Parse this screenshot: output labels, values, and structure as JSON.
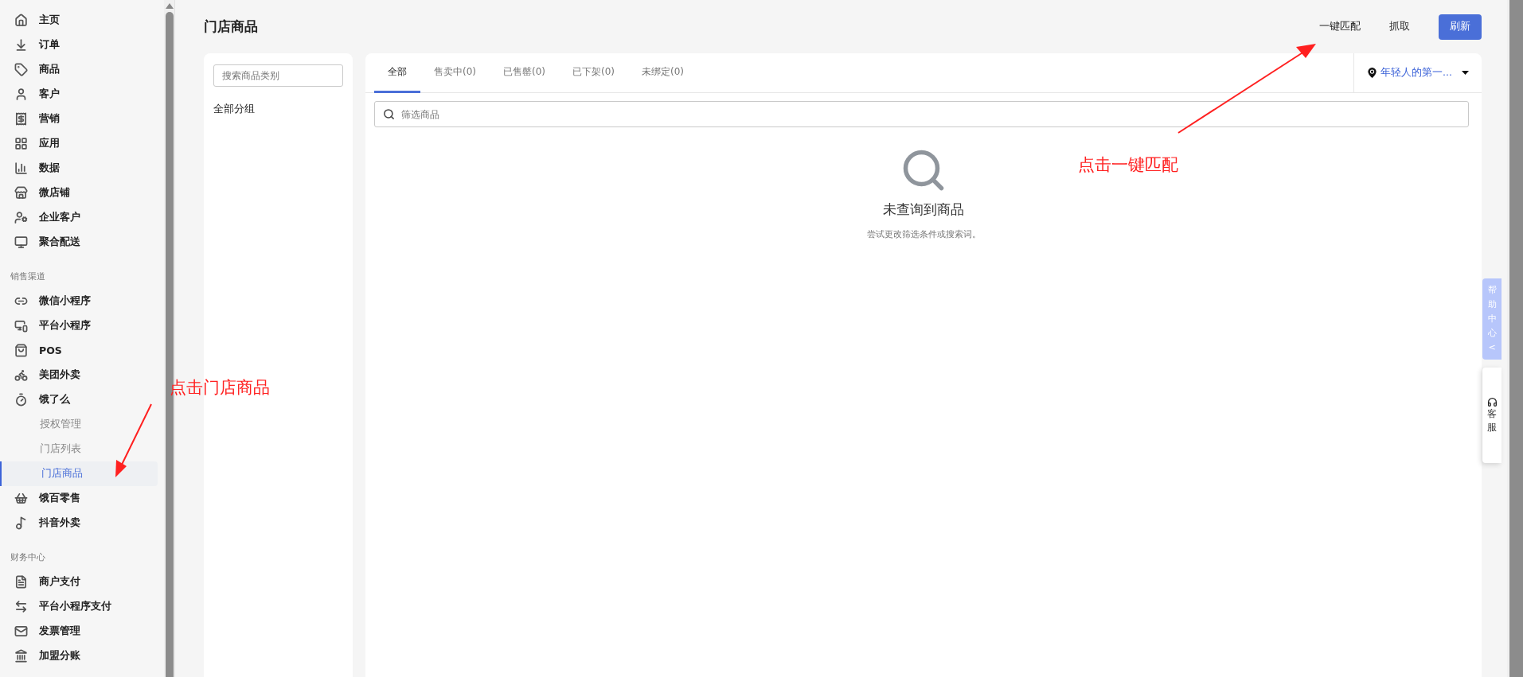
{
  "sidebar": {
    "groups": [
      {
        "items": [
          {
            "label": "主页",
            "selected": false
          },
          {
            "label": "订单",
            "selected": false
          },
          {
            "label": "商品",
            "selected": false
          },
          {
            "label": "客户",
            "selected": false
          },
          {
            "label": "营销",
            "selected": false
          },
          {
            "label": "应用",
            "selected": false
          },
          {
            "label": "数据",
            "selected": false
          },
          {
            "label": "微店铺",
            "selected": false
          },
          {
            "label": "企业客户",
            "selected": false
          },
          {
            "label": "聚合配送",
            "selected": false
          }
        ]
      },
      {
        "label": "销售渠道",
        "items": [
          {
            "label": "微信小程序",
            "selected": false
          },
          {
            "label": "平台小程序",
            "selected": false
          },
          {
            "label": "POS",
            "selected": false
          },
          {
            "label": "美团外卖",
            "selected": false
          },
          {
            "label": "饿了么",
            "selected": false,
            "children": [
              {
                "label": "授权管理",
                "selected": false
              },
              {
                "label": "门店列表",
                "selected": false
              },
              {
                "label": "门店商品",
                "selected": true
              }
            ]
          },
          {
            "label": "饿百零售",
            "selected": false
          },
          {
            "label": "抖音外卖",
            "selected": false
          }
        ]
      },
      {
        "label": "财务中心",
        "items": [
          {
            "label": "商户支付",
            "selected": false
          },
          {
            "label": "平台小程序支付",
            "selected": false
          },
          {
            "label": "发票管理",
            "selected": false
          },
          {
            "label": "加盟分账",
            "selected": false
          }
        ]
      }
    ]
  },
  "page": {
    "title": "门店商品",
    "actions": [
      "一键匹配",
      "抓取"
    ],
    "primary_action": "刷新"
  },
  "category_panel": {
    "search": {
      "placeholder": "搜索商品类别"
    },
    "items": [
      "全部分组"
    ]
  },
  "tabs": [
    {
      "label": "全部",
      "selected": true
    },
    {
      "label": "售卖中(0)",
      "selected": false
    },
    {
      "label": "已售罄(0)",
      "selected": false
    },
    {
      "label": "已下架(0)",
      "selected": false
    },
    {
      "label": "未绑定(0)",
      "selected": false
    }
  ],
  "store_selector": {
    "value": "年轻人的第一..."
  },
  "filter": {
    "placeholder": "筛选商品"
  },
  "empty_state": {
    "title": "未查询到商品",
    "hint": "尝试更改筛选条件或搜索词。"
  },
  "side_widgets": {
    "help": [
      "帮",
      "助",
      "中",
      "心",
      "<"
    ],
    "service": [
      "客",
      "服"
    ]
  },
  "annotations": [
    {
      "text": "点击门店商品"
    },
    {
      "text": "点击一键匹配"
    }
  ]
}
